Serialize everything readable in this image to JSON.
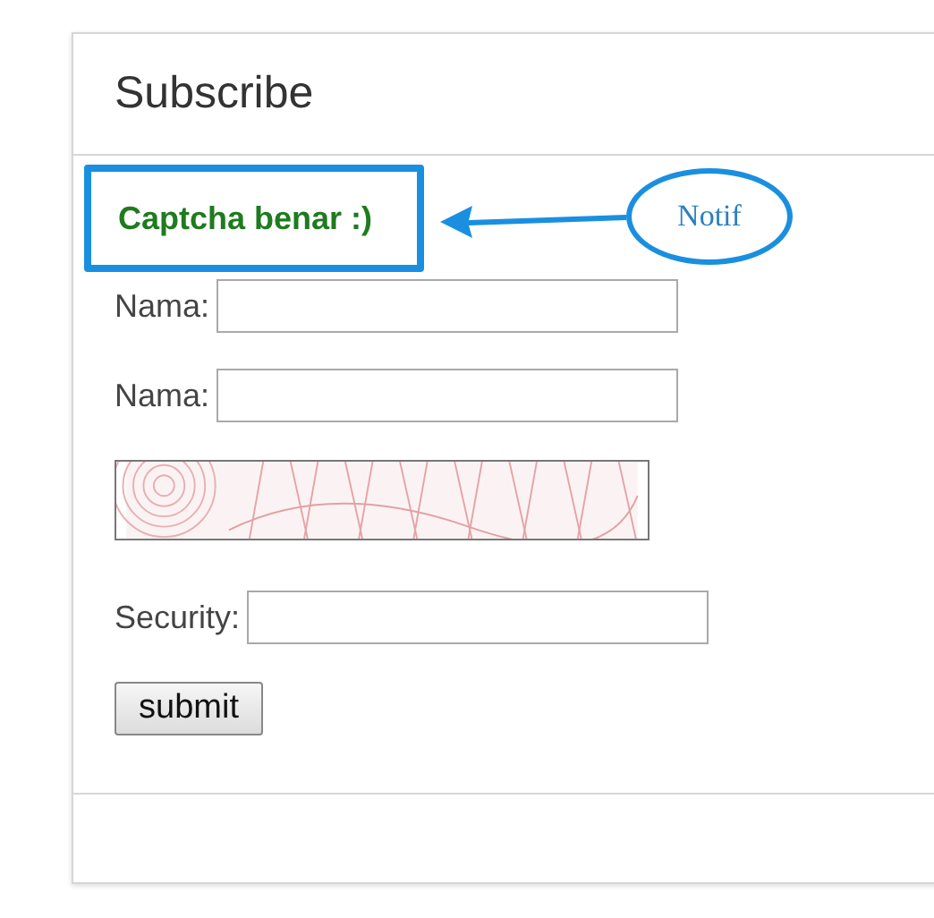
{
  "panel": {
    "title": "Subscribe"
  },
  "notification": {
    "text": "Captcha benar :)",
    "highlighted": true
  },
  "annotation": {
    "label": "Notif"
  },
  "fields": [
    {
      "label": "Nama:",
      "kind": "text"
    },
    {
      "label": "Nama:",
      "kind": "text"
    },
    {
      "kind": "captcha"
    },
    {
      "label": "Security:",
      "kind": "text"
    }
  ],
  "submit": {
    "label": "submit"
  }
}
